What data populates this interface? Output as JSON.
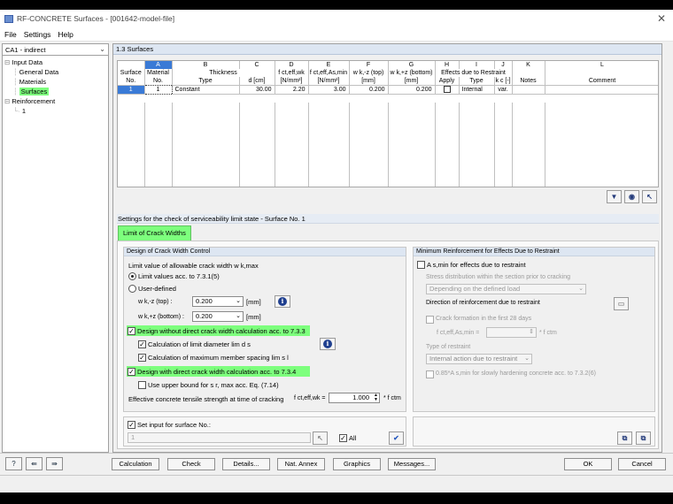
{
  "window": {
    "title": "RF-CONCRETE Surfaces - [001642-model-file]"
  },
  "menu": [
    "File",
    "Settings",
    "Help"
  ],
  "nav": {
    "case": "CA1 - indirect",
    "tree": [
      "Input Data",
      "General Data",
      "Materials",
      "Surfaces",
      "Reinforcement",
      "1"
    ]
  },
  "section_title": "1.3 Surfaces",
  "grid": {
    "letters": [
      "A",
      "B",
      "C",
      "D",
      "E",
      "F",
      "G",
      "H",
      "I",
      "J",
      "K",
      "L"
    ],
    "hdr_row1": [
      "Surface",
      "Material",
      "Thickness",
      "",
      "f ct,eff,wk",
      "f ct,eff,As,min",
      "w k,-z (top)",
      "w k,+z (bottom)",
      "Effects due to Restraint",
      "Notes",
      "Comment"
    ],
    "hdr_row2": [
      "No.",
      "No.",
      "Type",
      "d [cm]",
      "[N/mm²]",
      "[N/mm²]",
      "[mm]",
      "[mm]",
      "Apply",
      "Type",
      "k c [-]",
      "Notes",
      "Comment"
    ],
    "row": {
      "no": "1",
      "material": "1",
      "type": "Constant",
      "d": "30.00",
      "fctwk": "2.20",
      "fctas": "3.00",
      "wtop": "0.200",
      "wbot": "0.200",
      "restraint_type": "Internal",
      "kc": "var.",
      "notes": "",
      "comment": ""
    }
  },
  "sls": {
    "heading": "Settings for the check of serviceability limit state - Surface No. 1",
    "tab": "Limit of Crack Widths",
    "left_group": "Design of Crack Width Control",
    "limit_label": "Limit value of allowable crack width w k,max",
    "opt1": "Limit values acc. to 7.3.1(5)",
    "opt2": "User-defined",
    "wtop_label": "w k,-z (top) :",
    "wtop_val": "0.200",
    "wbot_label": "w k,+z (bottom) :",
    "wbot_val": "0.200",
    "unit_mm": "[mm]",
    "chk_without": "Design without direct crack width calculation acc. to 7.3.3",
    "chk_limdia": "Calculation of limit diameter lim d s",
    "chk_maxspc": "Calculation of maximum member spacing lim s l",
    "chk_with": "Design with direct crack width calculation acc. to 7.3.4",
    "chk_upper": "Use upper bound for s r, max acc. Eq. (7.14)",
    "eff_label": "Effective concrete tensile strength at time of cracking",
    "eff_sym": "f ct,eff,wk =",
    "eff_val": "1.000",
    "eff_unit": "* f ctm",
    "setinput": "Set input for surface No.:",
    "setinput_val": "1",
    "all": "All",
    "right_group": "Minimum Reinforcement for Effects Due to Restraint",
    "as_min": "A s,min for effects due to restraint",
    "stress_dist": "Stress distribution within the section prior to cracking",
    "stress_val": "Depending on the defined load",
    "direction": "Direction of reinforcement due to restraint",
    "crack28": "Crack formation in the first 28 days",
    "fct_as": "f ct,eff,As,min =",
    "fct_unit": "* f ctm",
    "restraint_type_label": "Type of restraint",
    "restraint_val": "Internal action due to restraint",
    "slow": "0.85*A s,min for slowly hardening concrete acc. to 7.3.2(6)"
  },
  "buttons": [
    "Calculation",
    "Check",
    "Details...",
    "Nat. Annex",
    "Graphics",
    "Messages...",
    "OK",
    "Cancel"
  ]
}
